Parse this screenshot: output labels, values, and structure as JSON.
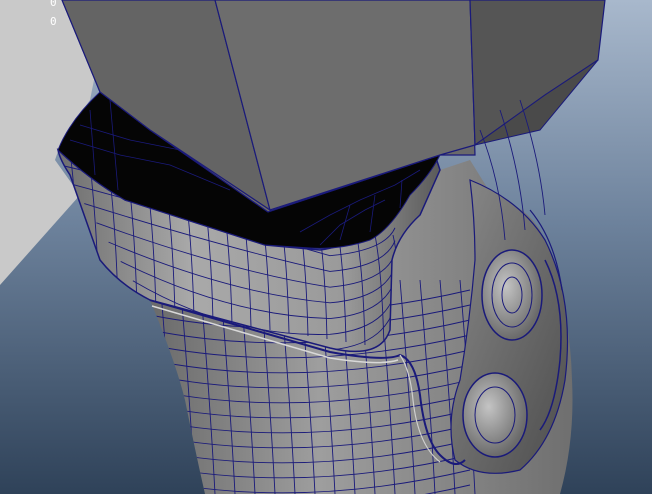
{
  "viewport": {
    "hud_values": [
      "0",
      "0"
    ],
    "colors": {
      "background_top": "#9fb1c6",
      "background_bottom": "#33475f",
      "grid_plane": "#c9c9c9",
      "mesh_shaded": "#8e8e8e",
      "mesh_dark": "#3f3f3f",
      "wireframe": "#1a1a7a",
      "cavity": "#050505"
    },
    "icons": [
      "perspective-viewport-icon",
      "wireframe-on-shaded-icon"
    ]
  }
}
